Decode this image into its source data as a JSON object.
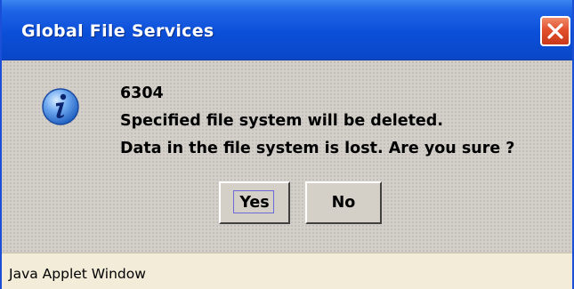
{
  "window": {
    "title": "Global File Services"
  },
  "dialog": {
    "icon": "info-icon",
    "message_code": "6304",
    "message_line1": "Specified file system will be deleted.",
    "message_line2": "Data in the file system is lost. Are you sure ?",
    "yes_label": "Yes",
    "no_label": "No"
  },
  "status": {
    "text": "Java Applet Window"
  },
  "colors": {
    "titlebar": "#0b4fd8",
    "close_button": "#e2502c",
    "dialog_bg": "#d4d0c8",
    "statusbar_bg": "#f2ecd8"
  }
}
